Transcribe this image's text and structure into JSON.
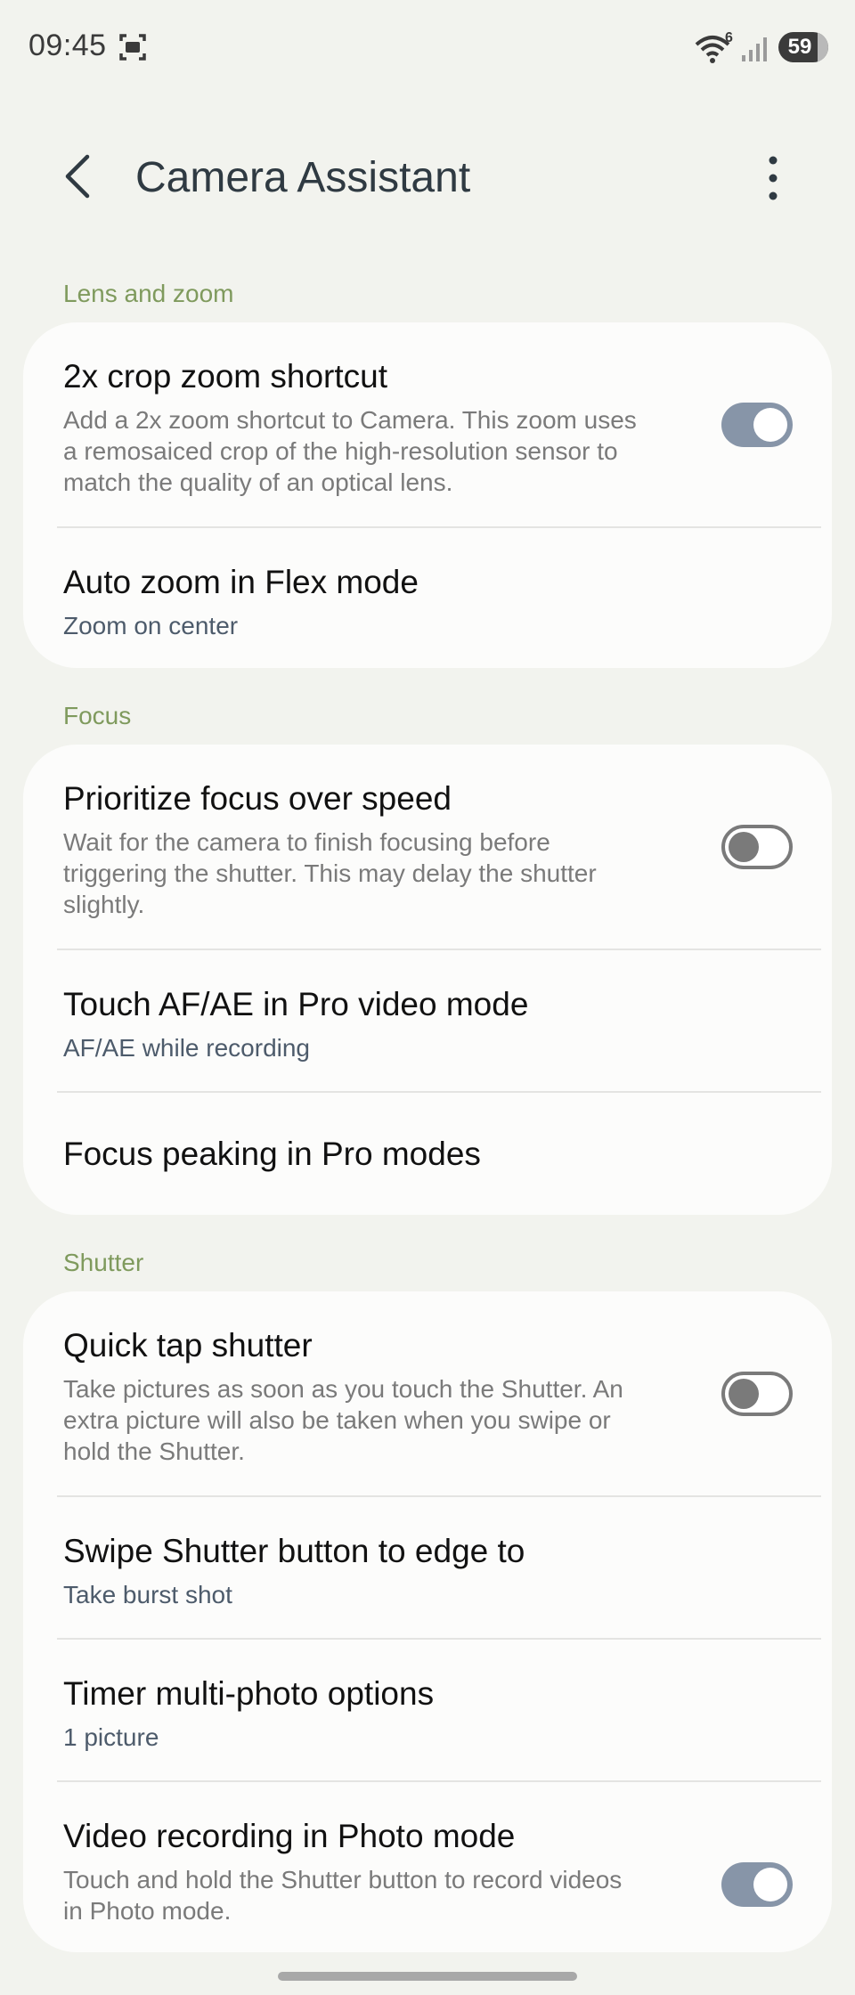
{
  "status": {
    "time": "09:45",
    "battery": "59",
    "wifi_badge": "6"
  },
  "appbar": {
    "title": "Camera Assistant"
  },
  "sections": {
    "lens": {
      "header": "Lens and zoom",
      "crop_zoom": {
        "title": "2x crop zoom shortcut",
        "desc_line1": "Add a 2x zoom shortcut to Camera. This zoom uses",
        "desc_line2": "a remosaiced crop of the high-resolution sensor to",
        "desc_line3": "match the quality of an optical lens.",
        "toggle": "on"
      },
      "auto_zoom": {
        "title": "Auto zoom in Flex mode",
        "value": "Zoom on center"
      }
    },
    "focus": {
      "header": "Focus",
      "prioritize": {
        "title": "Prioritize focus over speed",
        "desc_line1": "Wait for the camera to finish focusing before",
        "desc_line2": "triggering the shutter. This may delay the shutter",
        "desc_line3": "slightly.",
        "toggle": "off"
      },
      "touch_af": {
        "title": "Touch AF/AE in Pro video mode",
        "value": "AF/AE while recording"
      },
      "peaking": {
        "title": "Focus peaking in Pro modes"
      }
    },
    "shutter": {
      "header": "Shutter",
      "quick_tap": {
        "title": "Quick tap shutter",
        "desc_line1": "Take pictures as soon as you touch the Shutter. An",
        "desc_line2": "extra picture will also be taken when you swipe or",
        "desc_line3": "hold the Shutter.",
        "toggle": "off"
      },
      "swipe": {
        "title": "Swipe Shutter button to edge to",
        "value": "Take burst shot"
      },
      "timer": {
        "title": "Timer multi-photo options",
        "value": "1 picture"
      },
      "video_photo": {
        "title": "Video recording in Photo mode",
        "desc_line1": "Touch and hold the Shutter button to record videos",
        "desc_line2": "in Photo mode.",
        "toggle": "on"
      }
    }
  },
  "icons": {
    "screenshot": "screenshot-icon",
    "wifi": "wifi-icon",
    "signal": "signal-icon",
    "back": "back-icon",
    "more": "more-vert-icon"
  },
  "colors": {
    "background": "#f2f3ee",
    "card": "#fcfcfb",
    "section_header": "#7f9a5d",
    "toggle_on": "#8795a8",
    "toggle_off": "#7a7a7a"
  }
}
